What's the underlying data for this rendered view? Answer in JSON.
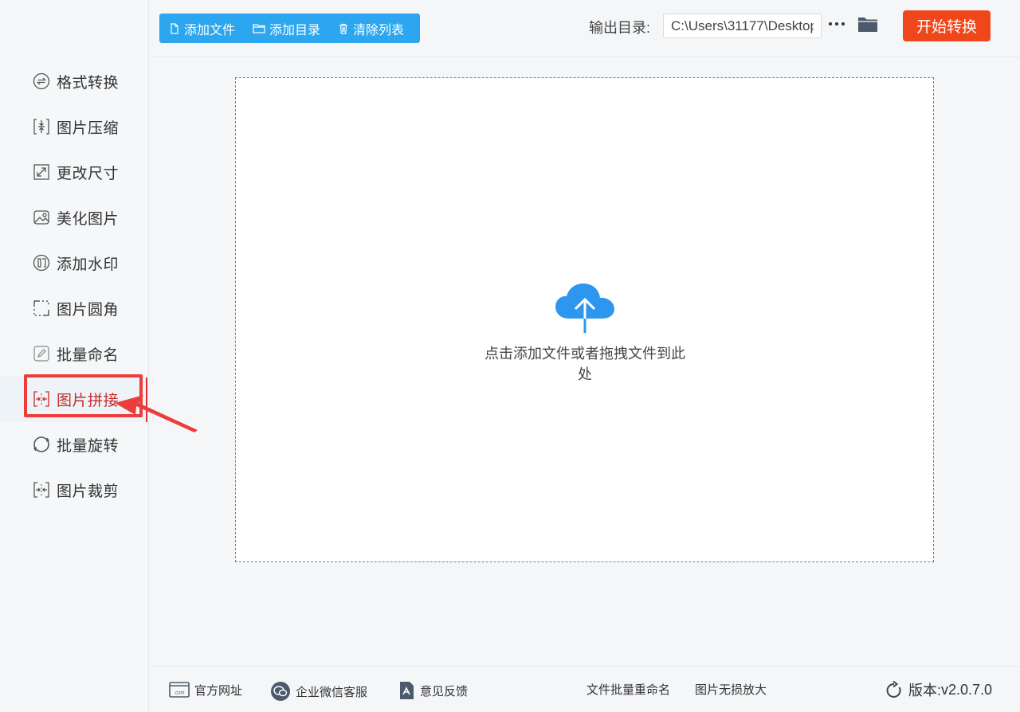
{
  "sidebar": {
    "items": [
      {
        "label": "格式转换",
        "icon": "format-convert-icon"
      },
      {
        "label": "图片压缩",
        "icon": "compress-icon"
      },
      {
        "label": "更改尺寸",
        "icon": "resize-icon"
      },
      {
        "label": "美化图片",
        "icon": "beautify-icon"
      },
      {
        "label": "添加水印",
        "icon": "watermark-icon"
      },
      {
        "label": "图片圆角",
        "icon": "rounded-corner-icon"
      },
      {
        "label": "批量命名",
        "icon": "rename-icon"
      },
      {
        "label": "图片拼接",
        "icon": "merge-icon",
        "active": true
      },
      {
        "label": "批量旋转",
        "icon": "rotate-icon"
      },
      {
        "label": "图片裁剪",
        "icon": "crop-icon"
      }
    ],
    "active_color": "#c52a2a",
    "highlight_color": "#ee3b3b"
  },
  "toolbar": {
    "add_file": "添加文件",
    "add_dir": "添加目录",
    "clear_list": "清除列表",
    "bg_color": "#2ba6ef"
  },
  "output": {
    "label": "输出目录:",
    "path": "C:\\Users\\31177\\Desktop"
  },
  "start_button": {
    "label": "开始转换",
    "color": "#f0461b"
  },
  "dropzone": {
    "text": "点击添加文件或者拖拽文件到此处",
    "icon": "cloud-upload-icon",
    "icon_color": "#2d96ee"
  },
  "footer": {
    "official_site": "官方网址",
    "wechat_service": "企业微信客服",
    "feedback": "意见反馈",
    "batch_rename": "文件批量重命名",
    "lossless_upscale": "图片无损放大",
    "version_label": "版本:",
    "version": "v2.0.7.0"
  }
}
